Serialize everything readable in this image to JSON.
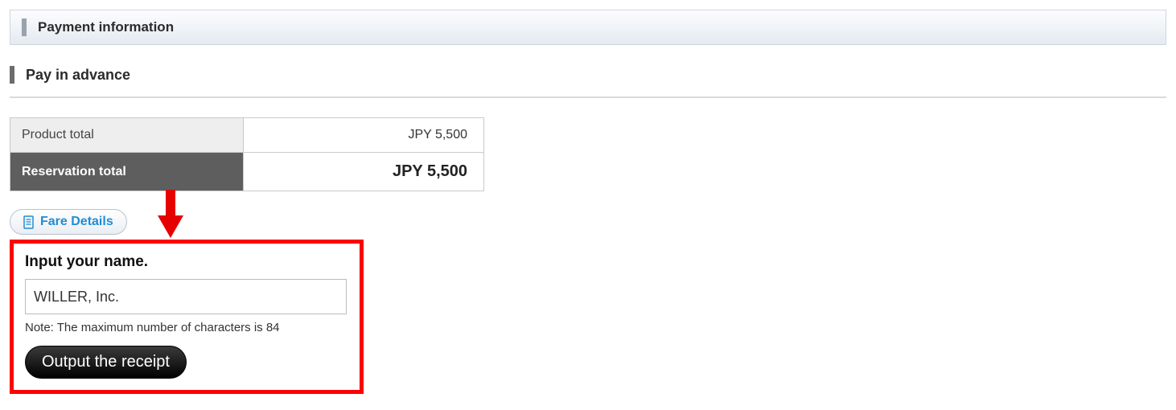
{
  "section": {
    "title": "Payment information"
  },
  "sub": {
    "title": "Pay in advance"
  },
  "totals": {
    "product_label": "Product total",
    "product_value": "JPY 5,500",
    "reservation_label": "Reservation total",
    "reservation_value": "JPY 5,500"
  },
  "fare_details": {
    "label": "Fare Details"
  },
  "receipt": {
    "prompt": "Input your name.",
    "value": "WILLER, Inc.",
    "note": "Note: The maximum number of characters is 84",
    "button": "Output the receipt"
  }
}
